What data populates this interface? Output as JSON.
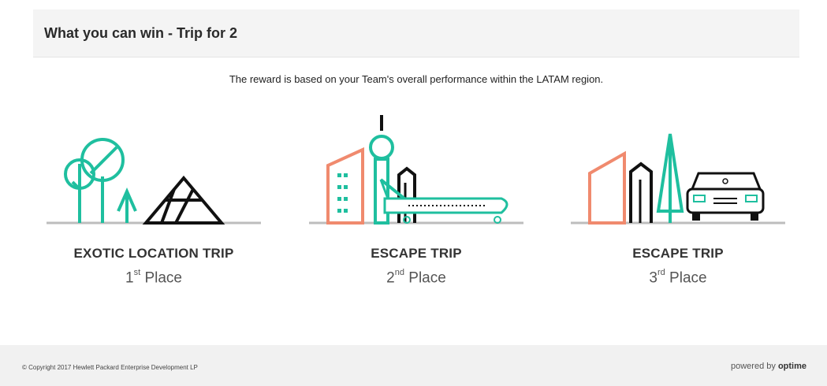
{
  "header": {
    "title": "What you can win - Trip for 2"
  },
  "intro": "The reward is based on your Team's overall performance within the LATAM region.",
  "prizes": [
    {
      "title": "EXOTIC LOCATION TRIP",
      "place_num": "1",
      "place_sup": "st",
      "place_label": "Place",
      "icon": "exotic-trip-illustration"
    },
    {
      "title": "ESCAPE TRIP",
      "place_num": "2",
      "place_sup": "nd",
      "place_label": "Place",
      "icon": "city-plane-illustration"
    },
    {
      "title": "ESCAPE TRIP",
      "place_num": "3",
      "place_sup": "rd",
      "place_label": "Place",
      "icon": "city-car-illustration"
    }
  ],
  "footer": {
    "copyright": "© Copyright 2017 Hewlett Packard Enterprise Development LP",
    "powered_prefix": "powered by",
    "powered_brand": "optime"
  },
  "colors": {
    "teal": "#1fbf9f",
    "coral": "#f08a6e",
    "dark": "#111111",
    "ground": "#bdbdbd"
  }
}
